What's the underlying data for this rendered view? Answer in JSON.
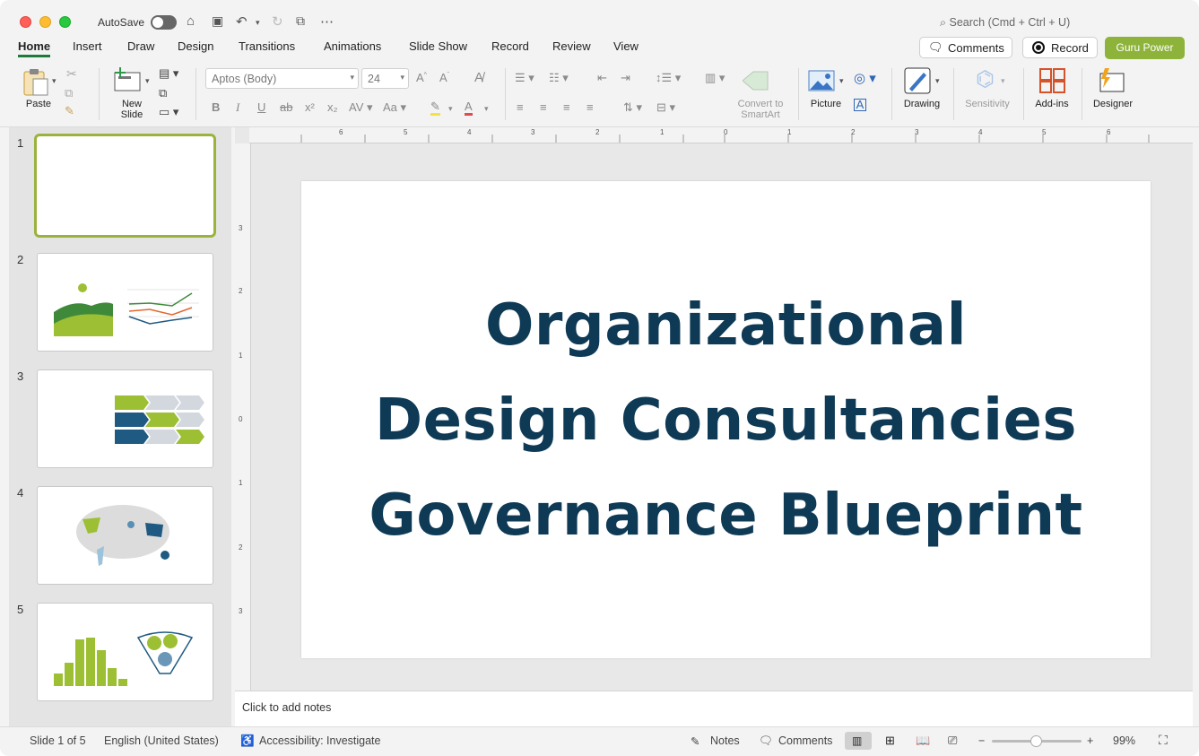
{
  "titlebar": {
    "autosave_label": "AutoSave",
    "search_placeholder": "Search (Cmd + Ctrl + U)"
  },
  "tabs": [
    "Home",
    "Insert",
    "Draw",
    "Design",
    "Transitions",
    "Animations",
    "Slide Show",
    "Record",
    "Review",
    "View"
  ],
  "active_tab": "Home",
  "header_buttons": {
    "comments": "Comments",
    "record": "Record",
    "guru": "Guru Power"
  },
  "ribbon": {
    "paste": "Paste",
    "new_slide_1": "New",
    "new_slide_2": "Slide",
    "font_name": "Aptos (Body)",
    "font_size": "24",
    "convert_1": "Convert to",
    "convert_2": "SmartArt",
    "picture": "Picture",
    "drawing": "Drawing",
    "sensitivity": "Sensitivity",
    "addins": "Add-ins",
    "designer": "Designer"
  },
  "thumbnails": [
    {
      "num": "1"
    },
    {
      "num": "2"
    },
    {
      "num": "3"
    },
    {
      "num": "4"
    },
    {
      "num": "5"
    }
  ],
  "slide": {
    "line1": "Organizational",
    "line2": "Design Consultancies",
    "line3": "Governance Blueprint"
  },
  "notes_placeholder": "Click to add notes",
  "statusbar": {
    "slide_count": "Slide 1 of 5",
    "language": "English (United States)",
    "accessibility": "Accessibility: Investigate",
    "notes": "Notes",
    "comments": "Comments",
    "zoom": "99%",
    "zoom_level": 0.5
  },
  "colors": {
    "accent": "#1e7b3a",
    "guru": "#8db33a",
    "title_text": "#0e3a56",
    "thumb_selected": "#9ab33c"
  }
}
